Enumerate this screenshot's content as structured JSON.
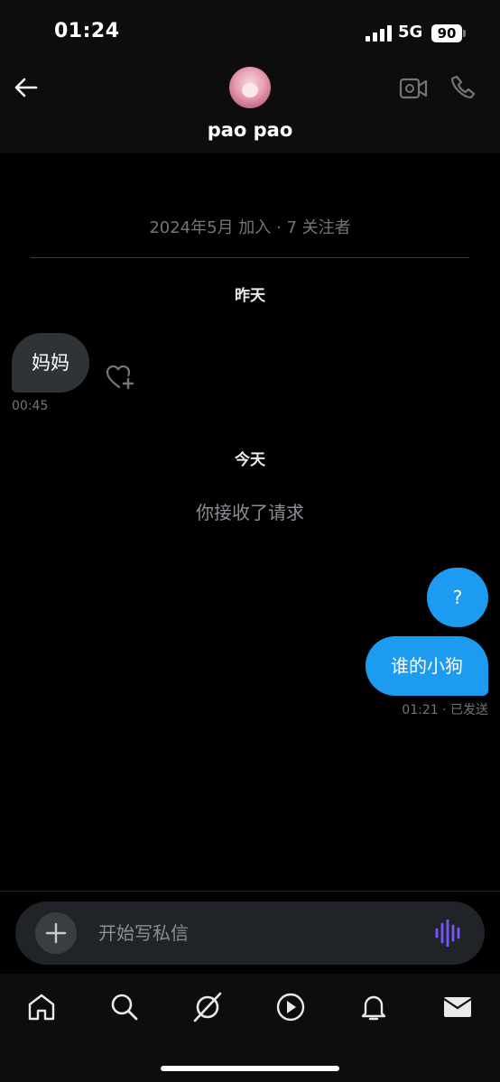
{
  "status_bar": {
    "time": "01:24",
    "network": "5G",
    "battery": "90"
  },
  "header": {
    "contact_name": "pao pao"
  },
  "conversation": {
    "join_info": "2024年5月 加入 · 7 关注者",
    "yesterday_label": "昨天",
    "incoming_message": "妈妈",
    "incoming_time": "00:45",
    "today_label": "今天",
    "request_note": "你接收了请求",
    "outgoing_messages": [
      "?",
      "谁的小狗"
    ],
    "outgoing_status": "01:21 · 已发送"
  },
  "composer": {
    "placeholder": "开始写私信"
  },
  "colors": {
    "accent": "#1d9bf0",
    "voice": "#7856ff",
    "incoming_bubble": "#2f3336"
  },
  "icons": [
    "back-arrow-icon",
    "video-call-icon",
    "phone-icon",
    "heart-plus-icon",
    "plus-icon",
    "voice-wave-icon",
    "home-icon",
    "search-icon",
    "grok-icon",
    "play-icon",
    "bell-icon",
    "mail-icon"
  ]
}
